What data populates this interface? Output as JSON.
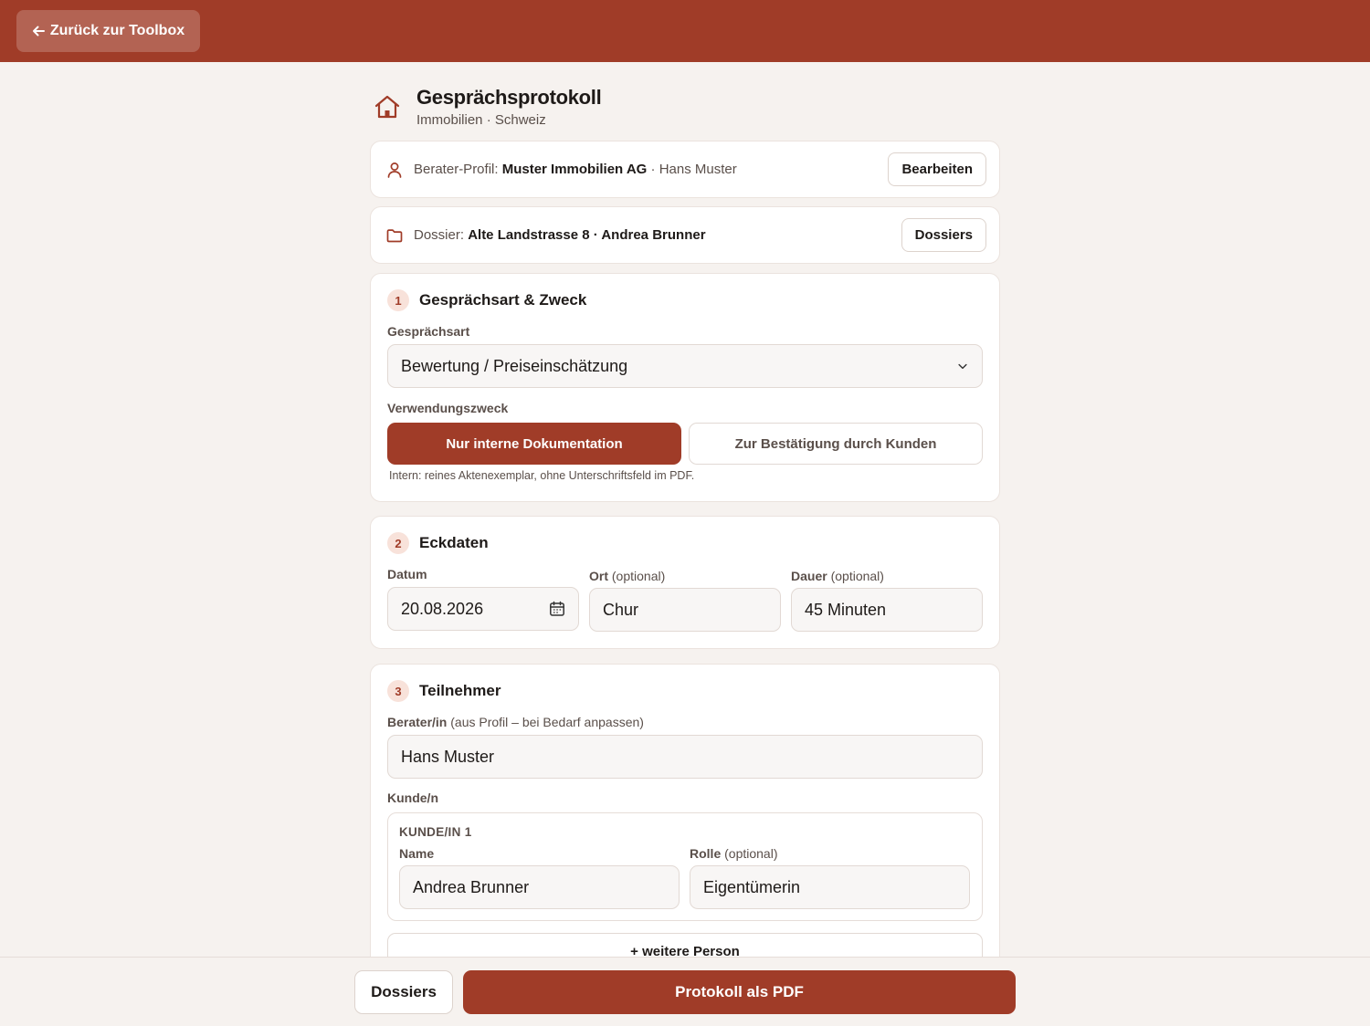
{
  "topbar": {
    "back_label": "Zurück zur Toolbox"
  },
  "header": {
    "title": "Gesprächsprotokoll",
    "subtitle": "Immobilien · Schweiz"
  },
  "profile": {
    "prefix": "Berater-Profil:",
    "company": "Muster Immobilien AG",
    "separator": " · ",
    "person": "Hans Muster",
    "edit_label": "Bearbeiten"
  },
  "dossier": {
    "prefix": "Dossier:",
    "value": "Alte Landstrasse 8 · Andrea Brunner",
    "button_label": "Dossiers"
  },
  "section1": {
    "number": "1",
    "title": "Gesprächsart & Zweck",
    "type_label": "Gesprächsart",
    "type_value": "Bewertung / Preiseinschätzung",
    "purpose_label": "Verwendungszweck",
    "purpose_options": [
      "Nur interne Dokumentation",
      "Zur Bestätigung durch Kunden"
    ],
    "purpose_selected": "Nur interne Dokumentation",
    "hint": "Intern: reines Aktenexemplar, ohne Unterschriftsfeld im PDF."
  },
  "section2": {
    "number": "2",
    "title": "Eckdaten",
    "date_label": "Datum",
    "date_value": "20.08.2026",
    "place_label": "Ort",
    "place_optional": "(optional)",
    "place_value": "Chur",
    "duration_label": "Dauer",
    "duration_optional": "(optional)",
    "duration_value": "45 Minuten"
  },
  "section3": {
    "number": "3",
    "title": "Teilnehmer",
    "advisor_label": "Berater/in",
    "advisor_note": "(aus Profil – bei Bedarf anpassen)",
    "advisor_value": "Hans Muster",
    "clients_label": "Kunde/n",
    "client": {
      "caption": "KUNDE/IN 1",
      "name_label": "Name",
      "name_value": "Andrea Brunner",
      "role_label": "Rolle",
      "role_optional": "(optional)",
      "role_value": "Eigentümerin"
    },
    "add_label": "+ weitere Person"
  },
  "footer": {
    "dossiers_label": "Dossiers",
    "pdf_label": "Protokoll als PDF"
  },
  "colors": {
    "brand": "#a03c28",
    "background": "#f6f2ef",
    "badge_bg": "#f8e2da"
  },
  "icons": [
    "arrow-left-icon",
    "home-icon",
    "user-icon",
    "folder-icon",
    "chevron-down-icon",
    "calendar-icon"
  ]
}
